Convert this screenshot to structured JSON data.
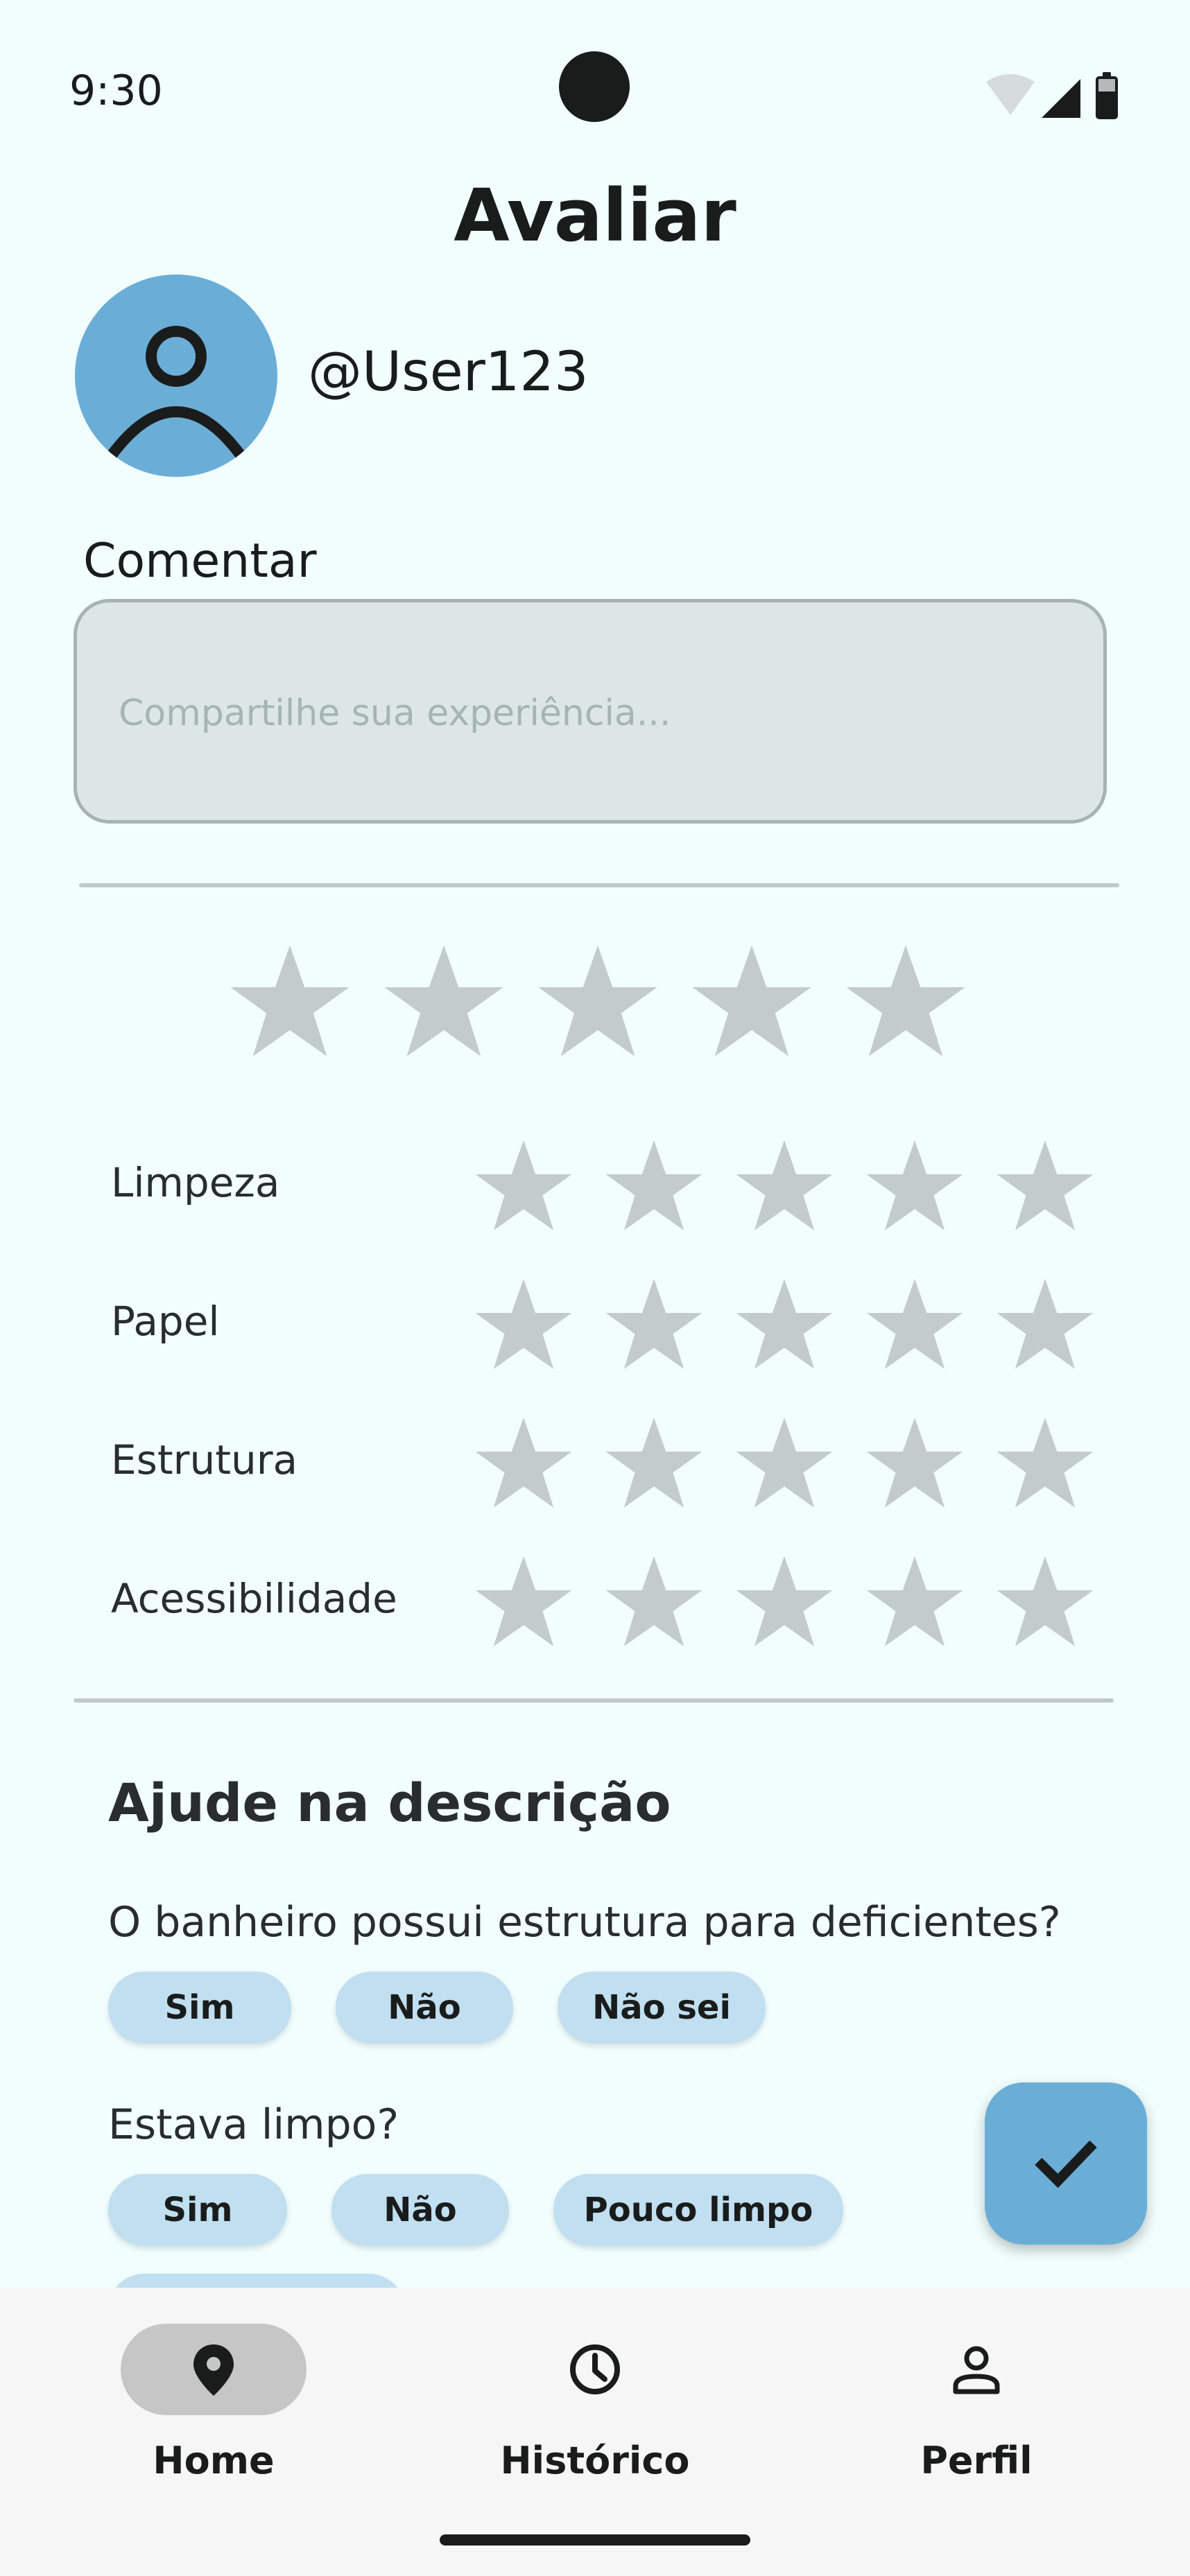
{
  "status_bar": {
    "time": "9:30"
  },
  "header": {
    "title": "Avaliar"
  },
  "user": {
    "handle": "@User123"
  },
  "comment": {
    "label": "Comentar",
    "placeholder": "Compartilhe sua experiência..."
  },
  "overall_rating": {
    "max": 5,
    "value": 0
  },
  "criteria": [
    {
      "label": "Limpeza",
      "value": 0,
      "max": 5
    },
    {
      "label": "Papel",
      "value": 0,
      "max": 5
    },
    {
      "label": "Estrutura",
      "value": 0,
      "max": 5
    },
    {
      "label": "Acessibilidade",
      "value": 0,
      "max": 5
    }
  ],
  "help": {
    "title": "Ajude na descrição",
    "questions": [
      {
        "text": "O banheiro possui estrutura para deficientes?",
        "options": [
          "Sim",
          "Não",
          "Não sei"
        ]
      },
      {
        "text": "Estava limpo?",
        "options": [
          "Sim",
          "Não",
          "Pouco limpo"
        ]
      }
    ]
  },
  "fab": {
    "icon": "check-icon"
  },
  "bottom_nav": {
    "items": [
      {
        "label": "Home",
        "icon": "location-pin-icon",
        "active": true
      },
      {
        "label": "Histórico",
        "icon": "clock-icon",
        "active": false
      },
      {
        "label": "Perfil",
        "icon": "person-icon",
        "active": false
      }
    ]
  },
  "colors": {
    "background": "#f2fefe",
    "avatar": "#6aaed8",
    "star_empty": "#c3cccb",
    "chip": "#c0dff0",
    "fab": "#6aaed8",
    "nav_active_pill": "#c6c6c6"
  }
}
